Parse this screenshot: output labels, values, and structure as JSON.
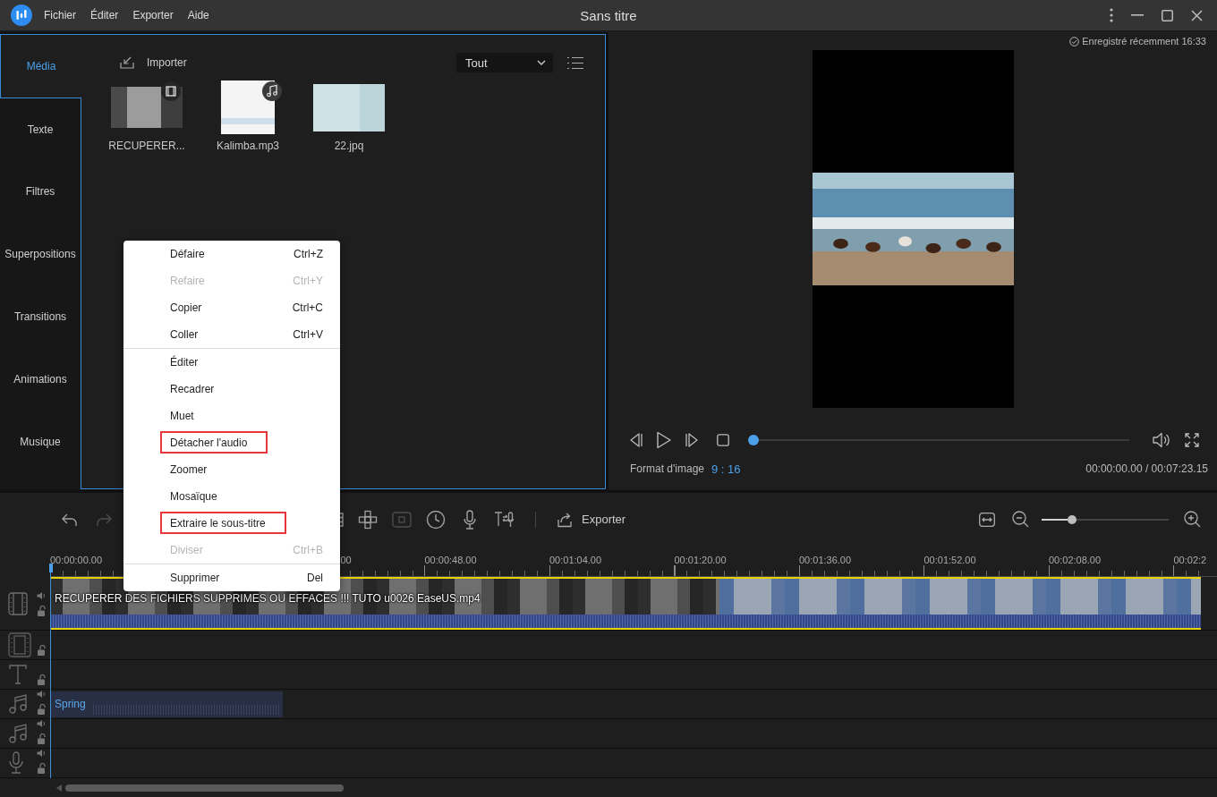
{
  "app": {
    "menu": [
      "Fichier",
      "Éditer",
      "Exporter",
      "Aide"
    ],
    "title": "Sans titre"
  },
  "library": {
    "tabs": [
      {
        "label": "Média",
        "selected": true
      },
      {
        "label": "Texte",
        "selected": false
      },
      {
        "label": "Filtres",
        "selected": false
      },
      {
        "label": "Superpositions",
        "selected": false
      },
      {
        "label": "Transitions",
        "selected": false
      },
      {
        "label": "Animations",
        "selected": false
      },
      {
        "label": "Musique",
        "selected": false
      }
    ],
    "import_label": "Importer",
    "filter": {
      "value": "Tout"
    },
    "items": [
      {
        "kind": "video",
        "name": "RECUPERER..."
      },
      {
        "kind": "audio",
        "name": "Kalimba.mp3"
      },
      {
        "kind": "image",
        "name": "22.jpq"
      }
    ]
  },
  "preview": {
    "saved_status": "Enregistré récemment 16:33",
    "progress": {
      "level": 0
    },
    "aspect_label": "Format d'image",
    "aspect_value": "9 : 16",
    "timecode": "00:00:00.00 / 00:07:23.15"
  },
  "timeline": {
    "tools": [
      {
        "kind": "undo",
        "disabled": false
      },
      {
        "kind": "redo",
        "disabled": true
      },
      {
        "kind": "bracket",
        "disabled": false
      },
      {
        "kind": "grid",
        "disabled": false
      },
      {
        "kind": "crop",
        "disabled": true
      },
      {
        "kind": "clock",
        "disabled": false
      },
      {
        "kind": "mic",
        "disabled": false
      },
      {
        "kind": "tts",
        "disabled": false
      }
    ],
    "export_label": "Exporter",
    "zoom": {
      "level": 0.22
    },
    "ruler": {
      "start_label": "00:00:00.00",
      "covered_label_tail": "00",
      "labels": [
        "00:00:48.00",
        "00:01:04.00",
        "00:01:20.00",
        "00:01:36.00",
        "00:01:52.00",
        "00:02:08.00",
        "00:02:2"
      ]
    },
    "tracks": [
      {
        "kind": "video",
        "audio": true,
        "locked": false,
        "clips": [
          {
            "kind": "video",
            "title": "RECUPERER DES FICHIERS SUPPRIMES OU EFFACES !!! TUTO u0026 EaseUS.mp4",
            "selected": true
          }
        ]
      },
      {
        "kind": "overlay",
        "audio": false,
        "locked": false
      },
      {
        "kind": "text",
        "audio": false,
        "locked": false
      },
      {
        "kind": "music",
        "audio": true,
        "locked": false,
        "clips": [
          {
            "kind": "audio",
            "title": "Spring",
            "selected": false
          }
        ]
      },
      {
        "kind": "music",
        "audio": true,
        "locked": false
      },
      {
        "kind": "voice",
        "audio": true,
        "locked": false
      }
    ]
  },
  "context_menu": {
    "groups": [
      {
        "items": [
          {
            "label": "Défaire",
            "shortcut": "Ctrl+Z",
            "disabled": false,
            "highlighted": false
          },
          {
            "label": "Refaire",
            "shortcut": "Ctrl+Y",
            "disabled": true,
            "highlighted": false
          },
          {
            "label": "Copier",
            "shortcut": "Ctrl+C",
            "disabled": false,
            "highlighted": false
          },
          {
            "label": "Coller",
            "shortcut": "Ctrl+V",
            "disabled": false,
            "highlighted": false
          }
        ]
      },
      {
        "items": [
          {
            "label": "Éditer",
            "disabled": false,
            "highlighted": false
          },
          {
            "label": "Recadrer",
            "disabled": false,
            "highlighted": false
          },
          {
            "label": "Muet",
            "disabled": false,
            "highlighted": false
          },
          {
            "label": "Détacher l'audio",
            "disabled": false,
            "highlighted": true
          },
          {
            "label": "Zoomer",
            "disabled": false,
            "highlighted": false
          },
          {
            "label": "Mosaïque",
            "disabled": false,
            "highlighted": false
          },
          {
            "label": "Extraire le sous-titre",
            "disabled": false,
            "highlighted": true
          },
          {
            "label": "Diviser",
            "shortcut": "Ctrl+B",
            "disabled": true,
            "highlighted": false
          }
        ]
      },
      {
        "items": [
          {
            "label": "Supprimer",
            "shortcut": "Del",
            "disabled": false,
            "highlighted": false
          }
        ]
      }
    ]
  }
}
